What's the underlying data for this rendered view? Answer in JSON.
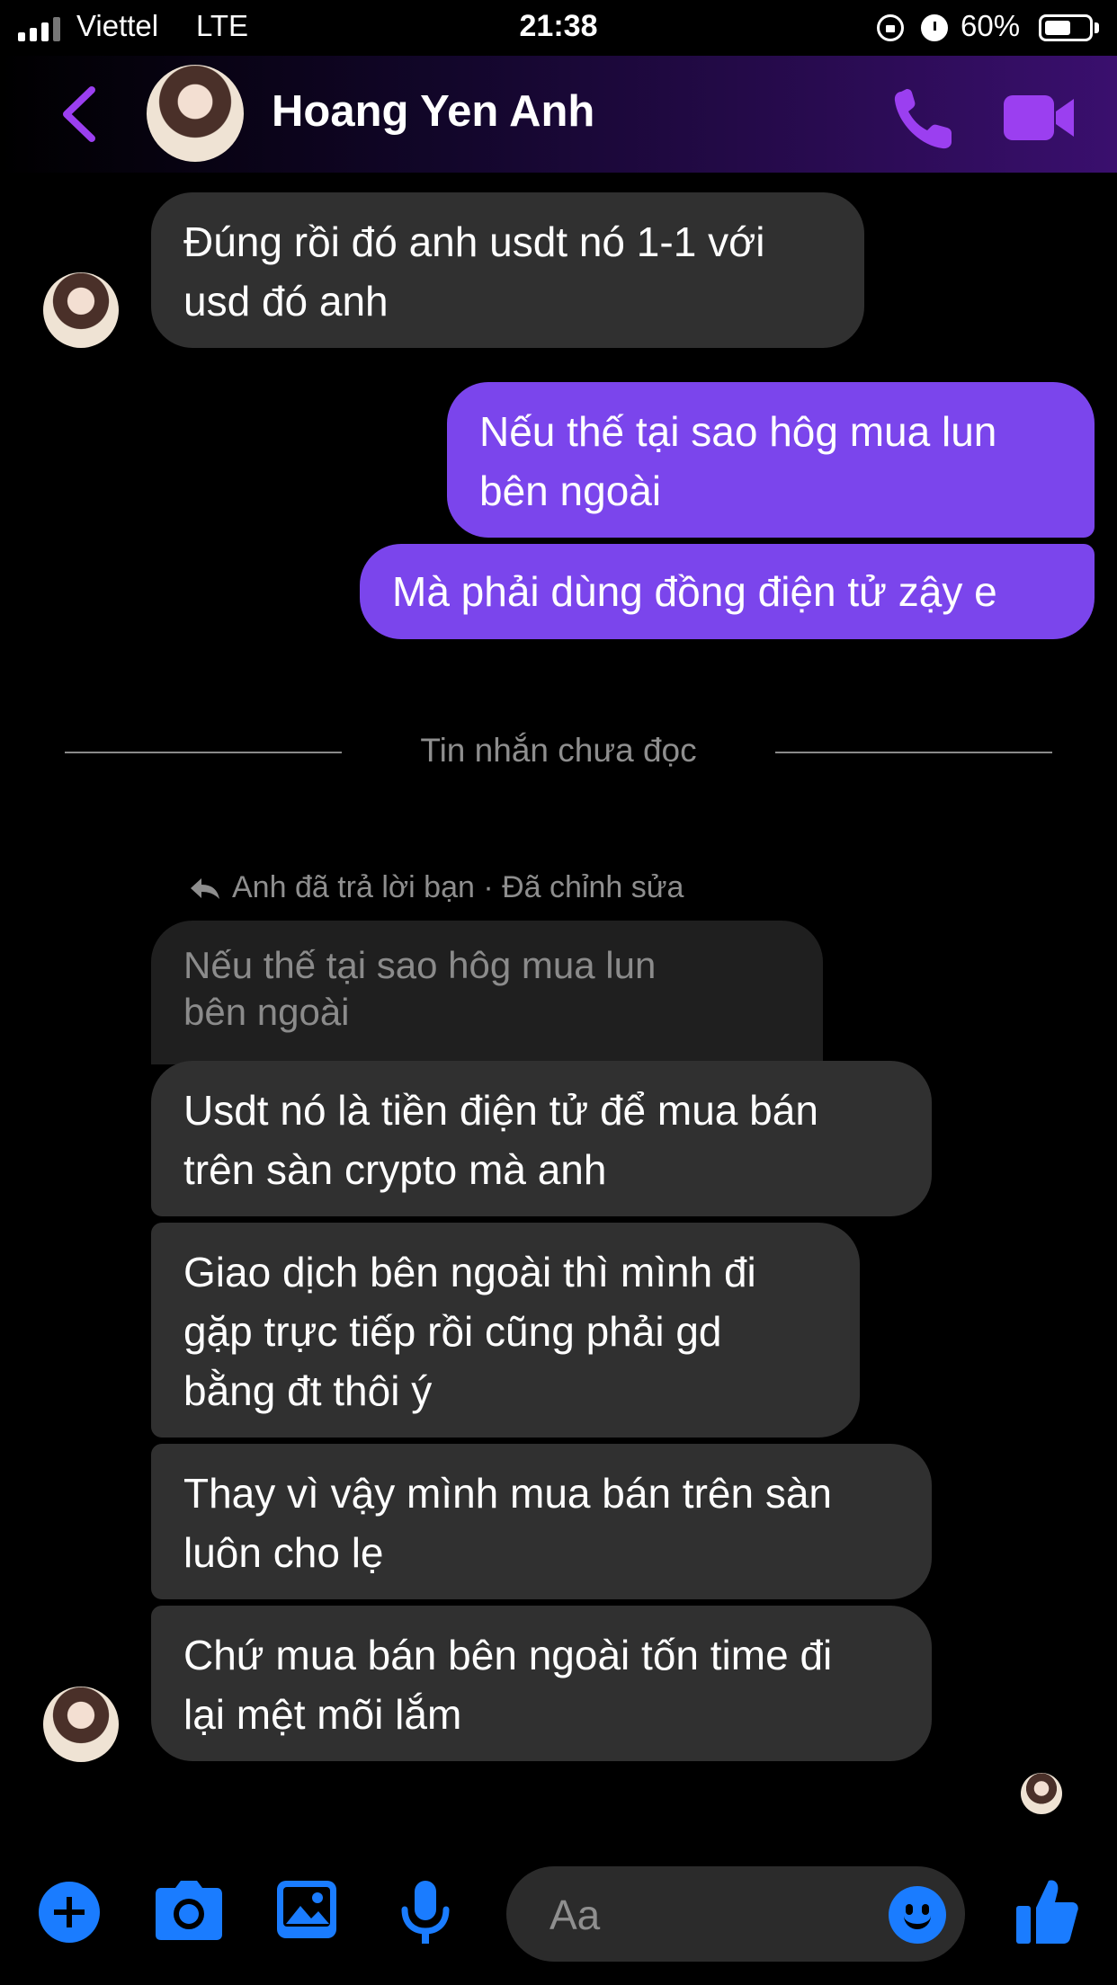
{
  "status_bar": {
    "carrier": "Viettel",
    "network": "LTE",
    "time": "21:38",
    "battery_percent": "60%",
    "battery_level": 0.6
  },
  "header": {
    "contact_name": "Hoang Yen Anh",
    "accent_color": "#9b3ff0"
  },
  "messages": [
    {
      "from": "them",
      "text": "Đúng rồi đó anh usdt nó 1-1 với\nusd đó anh"
    },
    {
      "from": "me",
      "text": "Nếu thế tại sao hôg mua lun\nbên ngoài"
    },
    {
      "from": "me",
      "text": "Mà phải dùng đồng điện tử zậy e"
    }
  ],
  "unread_divider": "Tin nhắn chưa đọc",
  "reply": {
    "meta": "Anh đã trả lời bạn · Đã chỉnh sửa",
    "quoted_text": "Nếu thế tại sao hôg mua lun\nbên ngoài"
  },
  "new_messages": [
    {
      "from": "them",
      "text": "Usdt nó là tiền điện tử để mua bán\ntrên sàn crypto mà anh"
    },
    {
      "from": "them",
      "text": "Giao dịch bên ngoài thì mình đi\ngặp trực tiếp rồi cũng phải gd\nbằng đt thôi ý"
    },
    {
      "from": "them",
      "text": "Thay vì vậy mình mua bán trên sàn\nluôn cho lẹ"
    },
    {
      "from": "them",
      "text": "Chứ mua bán bên ngoài tốn time đi\nlại mệt mõi lắm"
    }
  ],
  "composer": {
    "placeholder": "Aa",
    "tool_color": "#1a7cff"
  }
}
